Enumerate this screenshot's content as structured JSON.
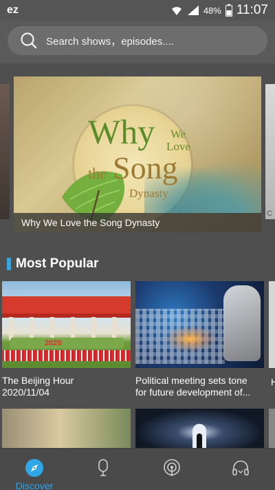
{
  "status_bar": {
    "app_glyph": "ez",
    "battery": "48%",
    "time": "11:07",
    "icons": [
      "wifi-icon",
      "signal-icon",
      "battery-icon"
    ]
  },
  "search": {
    "placeholder": "Search shows，episodes...."
  },
  "carousel": {
    "featured": {
      "caption": "Why We Love the Song Dynasty",
      "art_text": {
        "why": "Why",
        "we": "We",
        "love": "Love",
        "the": "the",
        "song": "Song",
        "dynasty": "Dynasty"
      }
    },
    "right_peek_label": "C"
  },
  "sections": {
    "most_popular": {
      "title": "Most Popular",
      "cards": [
        {
          "title_line1": "The Beijing Hour",
          "title_line2": "2020/11/04",
          "image_text": "2020"
        },
        {
          "title_line1": "Political meeting sets tone",
          "title_line2": "for future development of..."
        }
      ],
      "peek_text": "H"
    }
  },
  "bottom_nav": {
    "items": [
      {
        "label": "Discover",
        "icon": "discover-icon",
        "active": true
      },
      {
        "label": "",
        "icon": "microphone-icon",
        "active": false
      },
      {
        "label": "",
        "icon": "podcast-icon",
        "active": false
      },
      {
        "label": "",
        "icon": "headphones-icon",
        "active": false
      }
    ]
  },
  "colors": {
    "accent": "#2fa7e8",
    "background": "#4f4f4f",
    "search_bg": "#6d6d6d"
  }
}
